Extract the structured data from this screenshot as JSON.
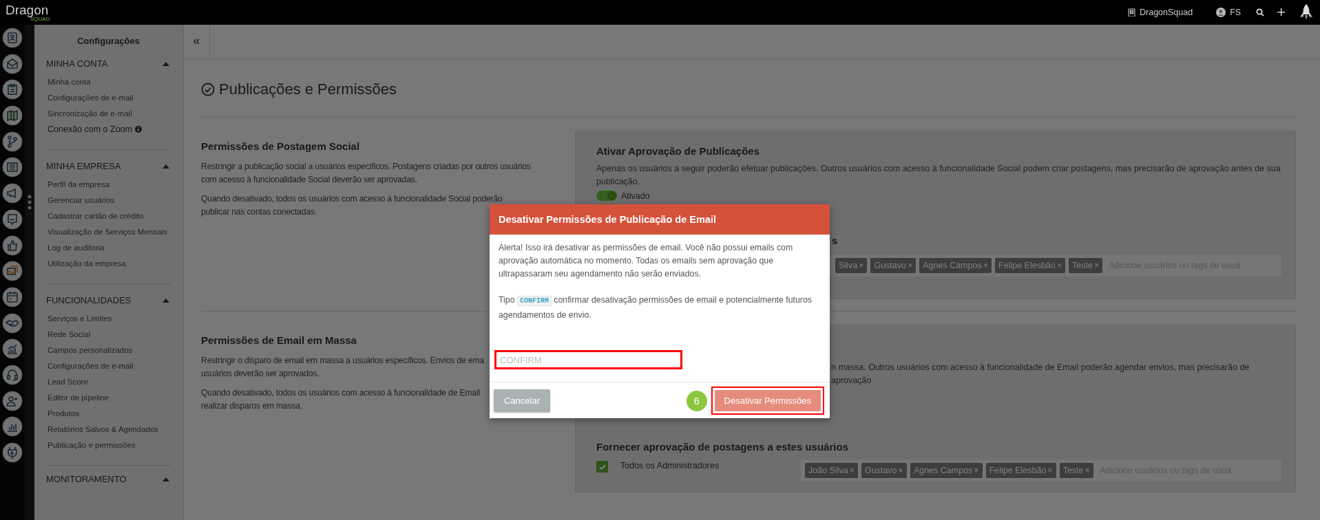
{
  "topbar": {
    "logo": "Dragon",
    "logo_sub": "SQUAD",
    "company": "DragonSquad",
    "user": "FS",
    "add": "+"
  },
  "sidebar": {
    "title": "Configurações",
    "sections": [
      {
        "title": "MINHA CONTA",
        "expanded": true,
        "items": [
          {
            "label": "Minha conta"
          },
          {
            "label": "Configurações de e-mail"
          },
          {
            "label": "Sincronização de e-mail"
          },
          {
            "label": "Conexão com o Zoom",
            "kind": "info"
          }
        ]
      },
      {
        "title": "MINHA EMPRESA",
        "expanded": true,
        "items": [
          {
            "label": "Perfil da empresa"
          },
          {
            "label": "Gerenciar usuários"
          },
          {
            "label": "Cadastrar cartão de crédito"
          },
          {
            "label": "Visualização de Serviços Mensais"
          },
          {
            "label": "Log de auditoria"
          },
          {
            "label": "Utilização da empresa"
          }
        ]
      },
      {
        "title": "FUNCIONALIDADES",
        "expanded": true,
        "items": [
          {
            "label": "Serviços e Limites"
          },
          {
            "label": "Rede Social"
          },
          {
            "label": "Campos personalizados"
          },
          {
            "label": "Configurações de e-mail"
          },
          {
            "label": "Lead Score"
          },
          {
            "label": "Editor de pipeline"
          },
          {
            "label": "Produtos"
          },
          {
            "label": "Relatórios Salvos & Agendados"
          },
          {
            "label": "Publicação e permissões"
          }
        ]
      },
      {
        "title": "MONITORAMENTO",
        "expanded": true
      }
    ]
  },
  "collapse_button": "«",
  "page": {
    "title": "Publicações e Permissões",
    "sections": [
      {
        "heading": "Permissões de Postagem Social",
        "paragraphs": [
          [
            "Restringir a publicação social a usuários específicos. Postagens criadas por outros usuários",
            "com acesso à funcionalidade Social deverão ser aprovadas."
          ],
          [
            "Quando desativado, todos os usuários com acesso à funcionalidade Social poderão",
            "publicar nas contas conectadas."
          ]
        ],
        "panel": {
          "title": "Ativar Aprovação de Publicações",
          "description": "Apenas os usuários a seguir poderão efetuar publicações. Outros usuários com acesso à funcionalidade Social podem criar postagens, mas precisarão de aprovação antes de sua publicação.",
          "toggle": {
            "on": true,
            "label": "Ativado"
          },
          "approvers_heading": "s",
          "tags": [
            {
              "name": "Silva",
              "remove": "×"
            },
            {
              "name": "Gustavo",
              "remove": "×"
            },
            {
              "name": "Agnes Campos",
              "remove": "×"
            },
            {
              "name": "Felipe Elesbão",
              "remove": "×"
            },
            {
              "name": "Teste",
              "remove": "×"
            }
          ],
          "tag_placeholder": "Adicione usuários ou tags de usuá"
        }
      },
      {
        "heading": "Permissões de Email em Massa",
        "paragraphs": [
          [
            "Restringir o disparo de email em massa a usuários específicos. Envios de ema",
            "usuários deverão ser aprovados."
          ],
          [
            "Quando desativado, todos os usuários com acesso à funcionalidade de Email",
            "realizar disparos em massa."
          ]
        ],
        "panel": {
          "description": "n massa. Outros usuários com acesso à funcionalidade de Email poderão agendar envios, mas precisarão de aprovação",
          "approvers_heading": "Fornecer aprovação de postagens a estes usuários",
          "admins": {
            "checked": true,
            "label": "Todos os Administradores"
          },
          "tags": [
            {
              "name": "João Silva",
              "remove": "×"
            },
            {
              "name": "Gustavo",
              "remove": "×"
            },
            {
              "name": "Agnes Campos",
              "remove": "×"
            },
            {
              "name": "Felipe Elesbão",
              "remove": "×"
            },
            {
              "name": "Teste",
              "remove": "×"
            }
          ],
          "tag_placeholder": "Adicione usuários ou tags de usuá"
        }
      }
    ]
  },
  "modal": {
    "title": "Desativar Permissões de Publicação de Email",
    "alert": "Alerta! Isso irá desativar as permissões de email. Você não possui emails com aprovação automática no momento. Todas os emails sem aprovação que ultrapassaram seu agendamento não serão enviados.",
    "instruction_before": "Tipo",
    "code": "CONFIRM",
    "instruction_after": "confirmar desativação permissões de email e potencialmente futuros agendamentos de envio.",
    "input_placeholder": "CONFIRM",
    "cancel": "Cancelar",
    "step": "6",
    "confirm": "Desativar Permissões"
  }
}
